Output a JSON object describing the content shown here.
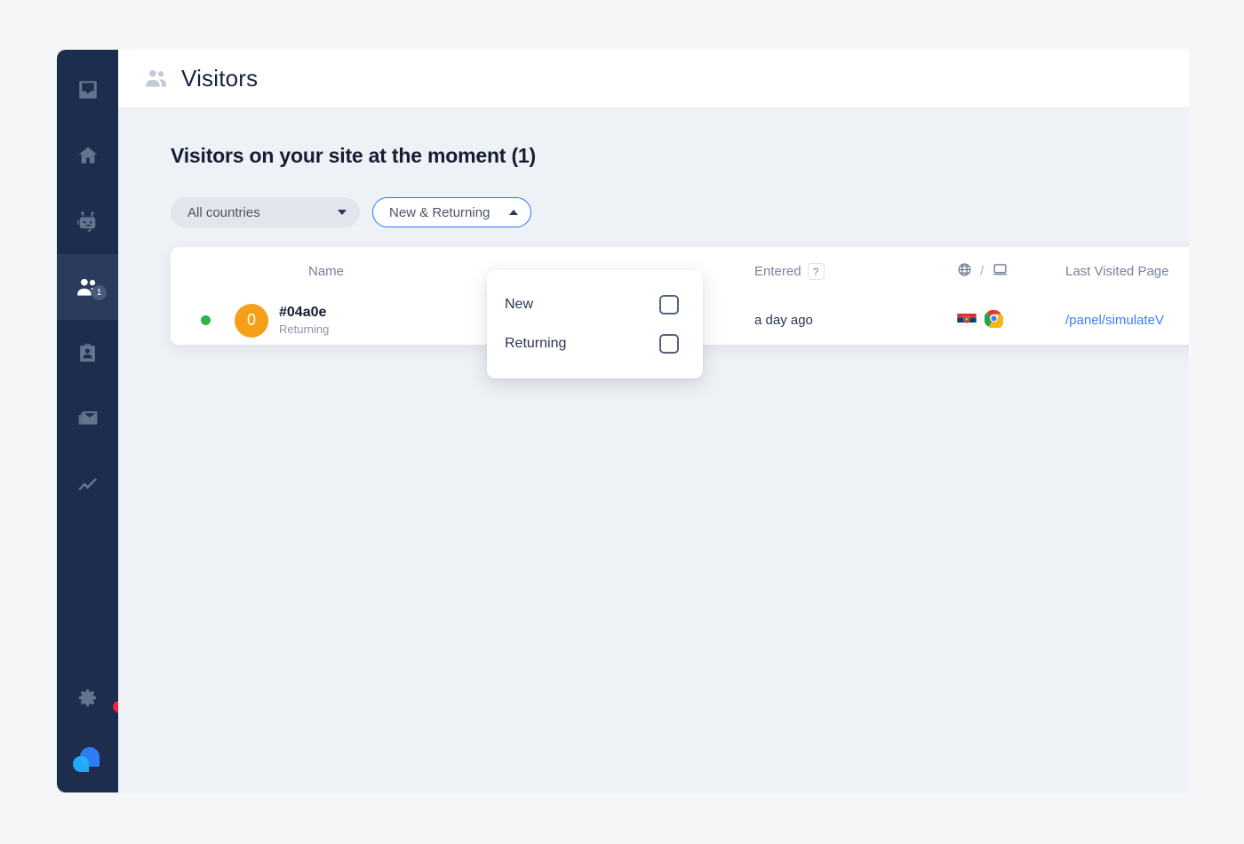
{
  "colors": {
    "page_background": "#f4f6f8",
    "sidebar": "#1d2d4d",
    "sidebar_active": "#2a3b5c",
    "content_background": "#eef1f5",
    "accent_blue": "#1f7bfd",
    "link_blue": "#3b7ff5",
    "avatar_orange": "#f6a019",
    "status_green": "#2cb34a",
    "notification_red": "#e8253a",
    "badge_gray": "#4a5a78"
  },
  "sidebar": {
    "items": [
      {
        "name": "inbox",
        "icon": "inbox-icon",
        "active": false
      },
      {
        "name": "home",
        "icon": "home-icon",
        "active": false
      },
      {
        "name": "chatbot",
        "icon": "robot-icon",
        "active": false
      },
      {
        "name": "visitors",
        "icon": "visitors-icon",
        "active": true,
        "badge": "1"
      },
      {
        "name": "contacts",
        "icon": "contact-card-icon",
        "active": false
      },
      {
        "name": "campaigns",
        "icon": "mail-icon",
        "active": false
      },
      {
        "name": "reports",
        "icon": "trend-line-icon",
        "active": false
      }
    ],
    "settings": {
      "icon": "gear-icon",
      "has_notification_dot": true
    },
    "logo": {
      "icon": "app-logo-icon"
    }
  },
  "topbar": {
    "icon": "visitors-icon",
    "title": "Visitors"
  },
  "main": {
    "section_title": "Visitors on your site at the moment (1)",
    "filters": {
      "country": {
        "label": "All countries",
        "caret": "chevron-down-icon",
        "open": false
      },
      "segment": {
        "label": "New & Returning",
        "caret": "chevron-up-icon",
        "open": true,
        "options": [
          {
            "label": "New",
            "checked": false
          },
          {
            "label": "Returning",
            "checked": false
          }
        ]
      }
    },
    "table": {
      "columns": {
        "name": "Name",
        "entered": "Entered",
        "entered_help": "?",
        "tech_globe": "globe-icon",
        "tech_separator": "/",
        "tech_device": "laptop-icon",
        "last_visited_page": "Last Visited Page"
      },
      "rows": [
        {
          "online": true,
          "avatar_initial": "0",
          "name": "#04a0e",
          "type": "Returning",
          "entered": "a day ago",
          "country_flag": "serbia-flag-icon",
          "browser": "chrome-icon",
          "last_visited_page": "/panel/simulateV"
        }
      ]
    }
  }
}
